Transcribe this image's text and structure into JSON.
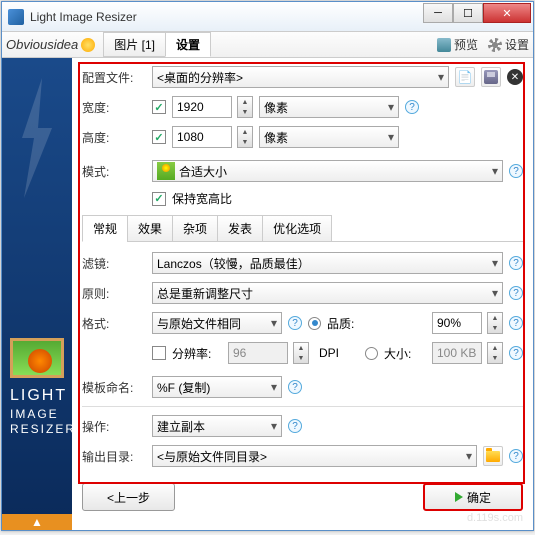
{
  "window": {
    "title": "Light Image Resizer"
  },
  "brand": "Obviousidea",
  "main_tabs": {
    "pictures": "图片 [1]",
    "settings": "设置"
  },
  "toolbar": {
    "preview": "预览",
    "settings": "设置"
  },
  "profile": {
    "label": "配置文件:",
    "value": "<桌面的分辨率>"
  },
  "width": {
    "label": "宽度:",
    "value": "1920",
    "unit": "像素"
  },
  "height": {
    "label": "高度:",
    "value": "1080",
    "unit": "像素"
  },
  "mode": {
    "label": "模式:",
    "value": "合适大小"
  },
  "aspect": {
    "label": "保持宽高比"
  },
  "subtabs": {
    "general": "常规",
    "effects": "效果",
    "misc": "杂项",
    "publish": "发表",
    "optimize": "优化选项"
  },
  "filter": {
    "label": "滤镜:",
    "value": "Lanczos（较慢，品质最佳）"
  },
  "policy": {
    "label": "原则:",
    "value": "总是重新调整尺寸"
  },
  "format": {
    "label": "格式:",
    "value": "与原始文件相同"
  },
  "quality": {
    "label": "品质:",
    "value": "90%"
  },
  "size": {
    "label": "大小:",
    "value": "100 KB"
  },
  "resolution": {
    "label": "分辨率:",
    "value": "96",
    "unit": "DPI"
  },
  "mask": {
    "label": "模板命名:",
    "value": "%F (复制)"
  },
  "action": {
    "label": "操作:",
    "value": "建立副本"
  },
  "output": {
    "label": "输出目录:",
    "value": "<与原始文件同目录>"
  },
  "buttons": {
    "back": "<上一步",
    "ok": "确定"
  },
  "sidebar": {
    "line1": "LIGHT",
    "line2": "IMAGE",
    "line3": "RESIZER"
  },
  "watermark": "d.119s.com"
}
